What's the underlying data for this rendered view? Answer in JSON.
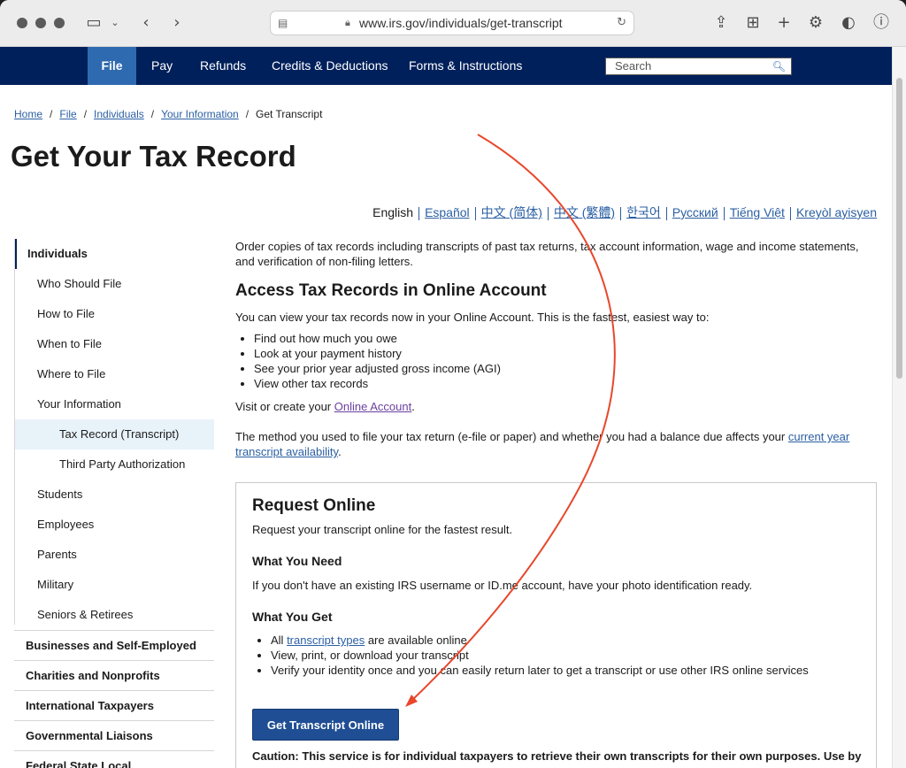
{
  "browser": {
    "url": "www.irs.gov/individuals/get-transcript"
  },
  "nav": {
    "items": [
      "File",
      "Pay",
      "Refunds",
      "Credits & Deductions",
      "Forms & Instructions"
    ],
    "search_placeholder": "Search"
  },
  "breadcrumb": {
    "links": [
      "Home",
      "File",
      "Individuals",
      "Your Information"
    ],
    "current": "Get Transcript"
  },
  "page_title": "Get Your Tax Record",
  "languages": {
    "current": "English",
    "links": [
      "Español",
      "中文 (简体)",
      "中文 (繁體)",
      "한국어",
      "Русский",
      "Tiếng Việt",
      "Kreyòl ayisyen"
    ]
  },
  "sidebar": {
    "top": "Individuals",
    "sub": [
      "Who Should File",
      "How to File",
      "When to File",
      "Where to File",
      "Your Information"
    ],
    "subsub": [
      "Tax Record (Transcript)",
      "Third Party Authorization"
    ],
    "sub_after": [
      "Students",
      "Employees",
      "Parents",
      "Military",
      "Seniors & Retirees"
    ],
    "sections": [
      "Businesses and Self-Employed",
      "Charities and Nonprofits",
      "International Taxpayers",
      "Governmental Liaisons",
      "Federal State Local"
    ]
  },
  "main": {
    "intro": "Order copies of tax records including transcripts of past tax returns, tax account information, wage and income statements, and verification of non-filing letters.",
    "online_heading": "Access Tax Records in Online Account",
    "online_text": "You can view your tax records now in your Online Account. This is the fastest, easiest way to:",
    "online_bullets": [
      "Find out how much you owe",
      "Look at your payment history",
      "See your prior year adjusted gross income (AGI)",
      "View other tax records"
    ],
    "visit_prefix": "Visit or create your ",
    "visit_link": "Online Account",
    "visit_suffix": ".",
    "method_text": "The method you used to file your tax return (e-file or paper) and whether you had a balance due affects  your ",
    "method_link": "current year transcript availability",
    "method_suffix": "."
  },
  "request": {
    "heading": "Request Online",
    "subtitle": "Request your transcript online for the fastest result.",
    "need_heading": "What You Need",
    "need_text": "If you don't have an existing IRS username or ID.me account, have your photo identification ready.",
    "get_heading": "What You Get",
    "bullet1_prefix": "All ",
    "bullet1_link": "transcript types",
    "bullet1_suffix": " are available online",
    "bullet2": "View, print, or download your transcript",
    "bullet3": "Verify your identity once and you can easily return later to get a transcript or use other IRS online services",
    "button": "Get Transcript Online",
    "caution": "Caution: This service is for individual taxpayers to retrieve their own transcripts for their own purposes. Use by"
  },
  "colors": {
    "header_navy": "#00205b",
    "active_tab": "#2e6ab0",
    "button_blue": "#1f4e94",
    "link_blue": "#2a5fa3",
    "annotation_arrow": "#e8472c"
  }
}
